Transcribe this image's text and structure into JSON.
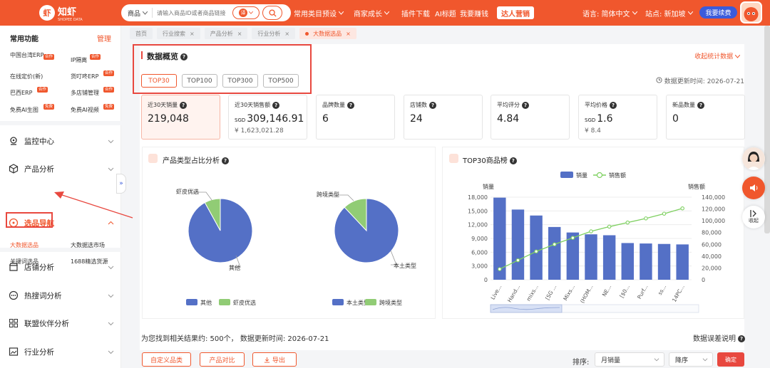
{
  "header": {
    "logo_text": "知虾",
    "logo_sub": "SHOPEE DATA",
    "search_category": "商品",
    "search_placeholder": "请输入商品ID或者商品链接",
    "translate_label": "译",
    "nav": [
      "常用类目预设",
      "商家成长",
      "插件下载",
      "AI标题",
      "我要赚钱"
    ],
    "talent_label": "达人营销",
    "language": "语言: 简体中文",
    "site": "站点: 新加坡",
    "renew_label": "我要续费"
  },
  "sidebar": {
    "title": "常用功能",
    "manage": "管理",
    "quick": [
      {
        "label": "中国台湾ERP",
        "badge": "合作"
      },
      {
        "label": "IP隔离",
        "badge": "合作"
      },
      {
        "label": "在线定价(新)",
        "badge": ""
      },
      {
        "label": "货叮咚ERP",
        "badge": "合作"
      },
      {
        "label": "巴西ERP",
        "badge": "合作"
      },
      {
        "label": "多店铺管理",
        "badge": "合作"
      },
      {
        "label": "免费AI生图",
        "badge": "免费"
      },
      {
        "label": "免费AI视频",
        "badge": "免费"
      }
    ],
    "menu": [
      "监控中心",
      "产品分析",
      "选品导航",
      "店铺分析",
      "热搜词分析",
      "联盟伙伴分析",
      "行业分析"
    ],
    "sub_items": [
      "大数据选品",
      "大数据选市场",
      "关键词选品",
      "1688精选货源"
    ]
  },
  "tabs": [
    "首页",
    "行业搜索",
    "产品分析",
    "行业分析",
    "大数据选品"
  ],
  "overview": {
    "title": "数据概览",
    "collapse_label": "收起统计数据",
    "update_time": "数据更新时间: 2026-07-21",
    "top_buttons": [
      "TOP30",
      "TOP100",
      "TOP300",
      "TOP500"
    ],
    "stats": [
      {
        "label": "近30天销量",
        "value": "219,048",
        "sub": "",
        "cur": ""
      },
      {
        "label": "近30天销售额",
        "value": "309,146.91",
        "sub": "¥ 1,623,021.28",
        "cur": "SGD"
      },
      {
        "label": "品牌数量",
        "value": "6",
        "sub": "",
        "cur": ""
      },
      {
        "label": "店铺数",
        "value": "24",
        "sub": "",
        "cur": ""
      },
      {
        "label": "平均评分",
        "value": "4.84",
        "sub": "",
        "cur": ""
      },
      {
        "label": "平均价格",
        "value": "1.6",
        "sub": "¥ 8.4",
        "cur": "SGD"
      },
      {
        "label": "新品数量",
        "value": "0",
        "sub": "",
        "cur": ""
      }
    ]
  },
  "colors": {
    "accent": "#f0572d",
    "blue": "#5470c6",
    "green": "#91cc75",
    "line": "#7ed060"
  },
  "chart_data": [
    {
      "type": "pie",
      "title": "产品类型占比分析",
      "labels": [
        "其他",
        "虾皮优选"
      ],
      "values": [
        92,
        8
      ],
      "legend": "bottom"
    },
    {
      "type": "pie",
      "labels": [
        "本土类型",
        "跨境类型"
      ],
      "values": [
        88,
        12
      ],
      "legend": "bottom"
    },
    {
      "type": "bar",
      "title": "TOP30商品榜",
      "categories": [
        "Live...",
        "Hand...",
        "mixs...",
        "[SG ...",
        "Mixs...",
        "(HOM...",
        "NE...",
        "[$0...",
        "Purf...",
        "ss...",
        "14PC..."
      ],
      "series": [
        {
          "name": "销量",
          "type": "bar",
          "values": [
            17900,
            15300,
            14000,
            11500,
            10300,
            9900,
            9700,
            8000,
            7900,
            7800,
            7700
          ]
        },
        {
          "name": "销售额",
          "type": "line",
          "values": [
            18000,
            33000,
            48000,
            60000,
            71000,
            82000,
            90000,
            97000,
            104000,
            112000,
            121000
          ]
        }
      ],
      "ylabel": "销量",
      "y2label": "销售额",
      "ylim": [
        0,
        18000
      ],
      "y2lim": [
        0,
        140000
      ],
      "yticks": [
        "18,000",
        "15,000",
        "12,000",
        "9,000",
        "6,000",
        "3,000",
        "0"
      ],
      "y2ticks": [
        "140,000",
        "120,000",
        "100,000",
        "80,000",
        "60,000",
        "40,000",
        "20,000",
        "0"
      ],
      "legend": "top"
    }
  ],
  "results": {
    "summary": "为您找到相关结果约: 500个， 数据更新时间: 2026-07-21",
    "error_link": "数据误差说明",
    "buttons": [
      "自定义品类",
      "产品对比",
      "导出"
    ],
    "sort_label": "排序:",
    "sort_field": "月销量",
    "sort_order": "降序",
    "confirm": "确定"
  },
  "float": {
    "collapse": "收起"
  }
}
